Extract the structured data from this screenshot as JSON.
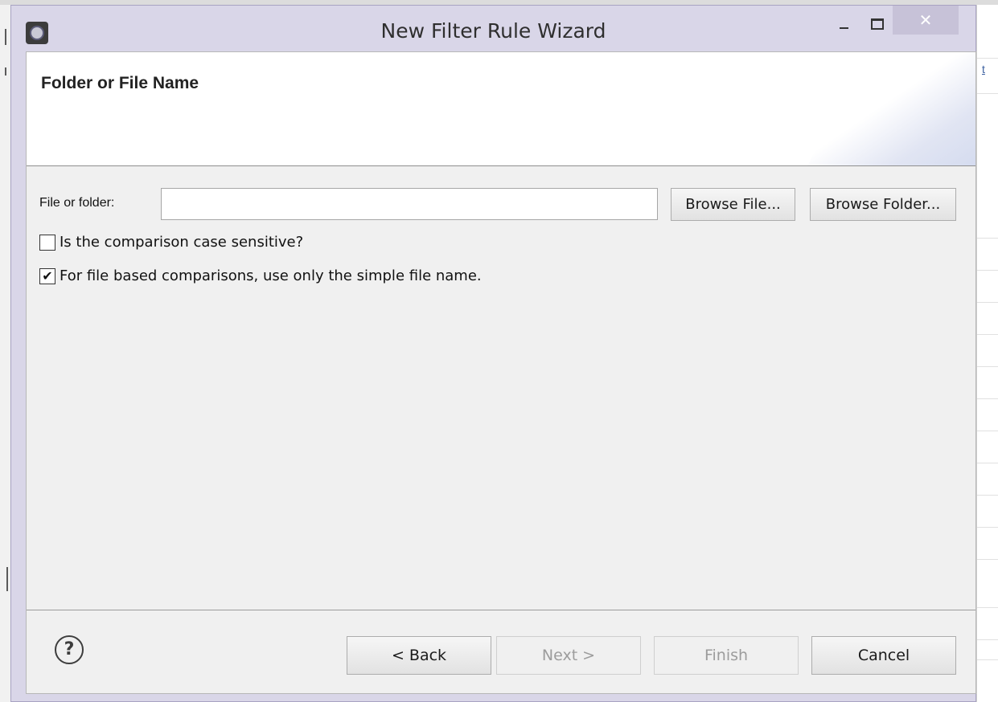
{
  "window": {
    "title": "New Filter Rule Wizard",
    "close_glyph": "✕"
  },
  "page": {
    "title": "Folder or File Name"
  },
  "form": {
    "file_label": "File or folder:",
    "file_value": "",
    "browse_file_label": "Browse File...",
    "browse_folder_label": "Browse Folder...",
    "case_sensitive": {
      "label": "Is the comparison case sensitive?",
      "checked": false,
      "mark": ""
    },
    "simple_name": {
      "label": "For file based comparisons, use only the simple file name.",
      "checked": true,
      "mark": "✔"
    }
  },
  "footer": {
    "help_glyph": "?",
    "back_label": "< Back",
    "next_label": "Next >",
    "finish_label": "Finish",
    "cancel_label": "Cancel"
  },
  "background": {
    "right_link": "t"
  },
  "colors": {
    "frame": "#d9d6e8",
    "client": "#f0f0f0",
    "disabled_text": "#9c9c9c"
  }
}
